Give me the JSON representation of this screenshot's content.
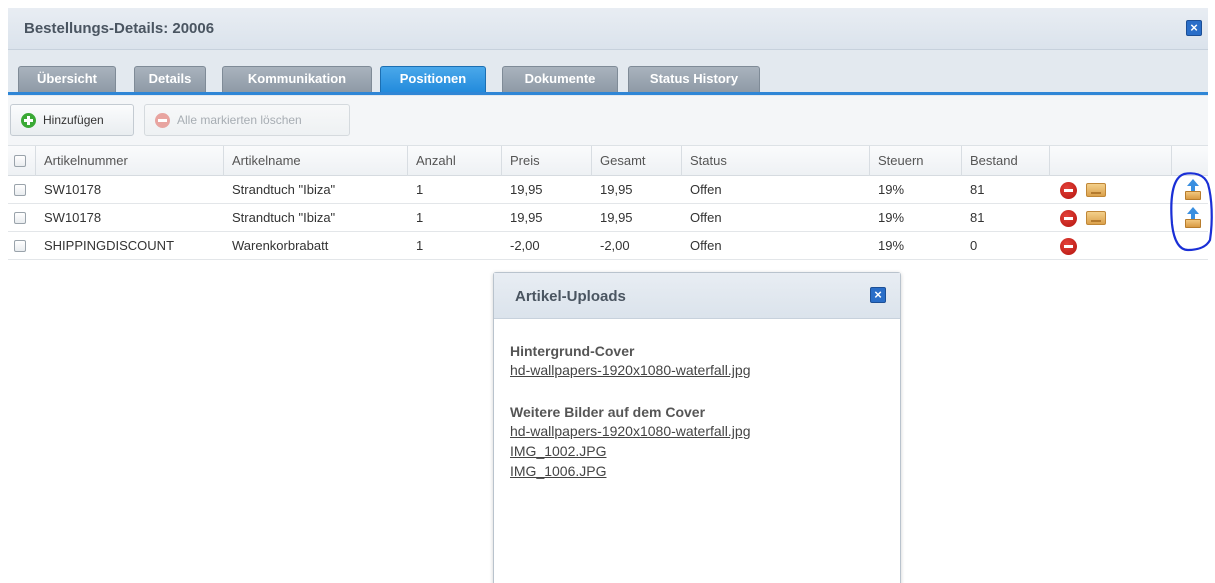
{
  "window": {
    "title": "Bestellungs-Details: 20006",
    "close_glyph": "×"
  },
  "tabs": [
    {
      "label": "Übersicht",
      "active": false
    },
    {
      "label": "Details",
      "active": false
    },
    {
      "label": "Kommunikation",
      "active": false
    },
    {
      "label": "Positionen",
      "active": true
    },
    {
      "label": "Dokumente",
      "active": false
    },
    {
      "label": "Status History",
      "active": false
    }
  ],
  "toolbar": {
    "add_label": "Hinzufügen",
    "delete_marked_label": "Alle markierten löschen"
  },
  "columns": [
    "Artikelnummer",
    "Artikelname",
    "Anzahl",
    "Preis",
    "Gesamt",
    "Status",
    "Steuern",
    "Bestand"
  ],
  "rows": [
    {
      "artikelnummer": "SW10178",
      "artikelname": "Strandtuch \"Ibiza\"",
      "anzahl": "1",
      "preis": "19,95",
      "gesamt": "19,95",
      "status": "Offen",
      "steuern": "19%",
      "bestand": "81",
      "actions": [
        "delete-icon",
        "mail-icon"
      ],
      "upload": true
    },
    {
      "artikelnummer": "SW10178",
      "artikelname": "Strandtuch \"Ibiza\"",
      "anzahl": "1",
      "preis": "19,95",
      "gesamt": "19,95",
      "status": "Offen",
      "steuern": "19%",
      "bestand": "81",
      "actions": [
        "delete-icon",
        "mail-icon"
      ],
      "upload": true
    },
    {
      "artikelnummer": "SHIPPINGDISCOUNT",
      "artikelname": "Warenkorbrabatt",
      "anzahl": "1",
      "preis": "-2,00",
      "gesamt": "-2,00",
      "status": "Offen",
      "steuern": "19%",
      "bestand": "0",
      "actions": [
        "delete-icon"
      ],
      "upload": false
    }
  ],
  "popup": {
    "title": "Artikel-Uploads",
    "close_glyph": "×",
    "sections": [
      {
        "title": "Hintergrund-Cover",
        "files": [
          "hd-wallpapers-1920x1080-waterfall.jpg"
        ]
      },
      {
        "title": "Weitere Bilder auf dem Cover",
        "files": [
          "hd-wallpapers-1920x1080-waterfall.jpg",
          "IMG_1002.JPG",
          "IMG_1006.JPG"
        ]
      }
    ]
  },
  "colors": {
    "accent": "#2f86d6",
    "tab_active": "#238bdc",
    "tab_inactive": "#8e9aa6",
    "delete": "#c81f17",
    "annotation": "#1a2fd6"
  }
}
